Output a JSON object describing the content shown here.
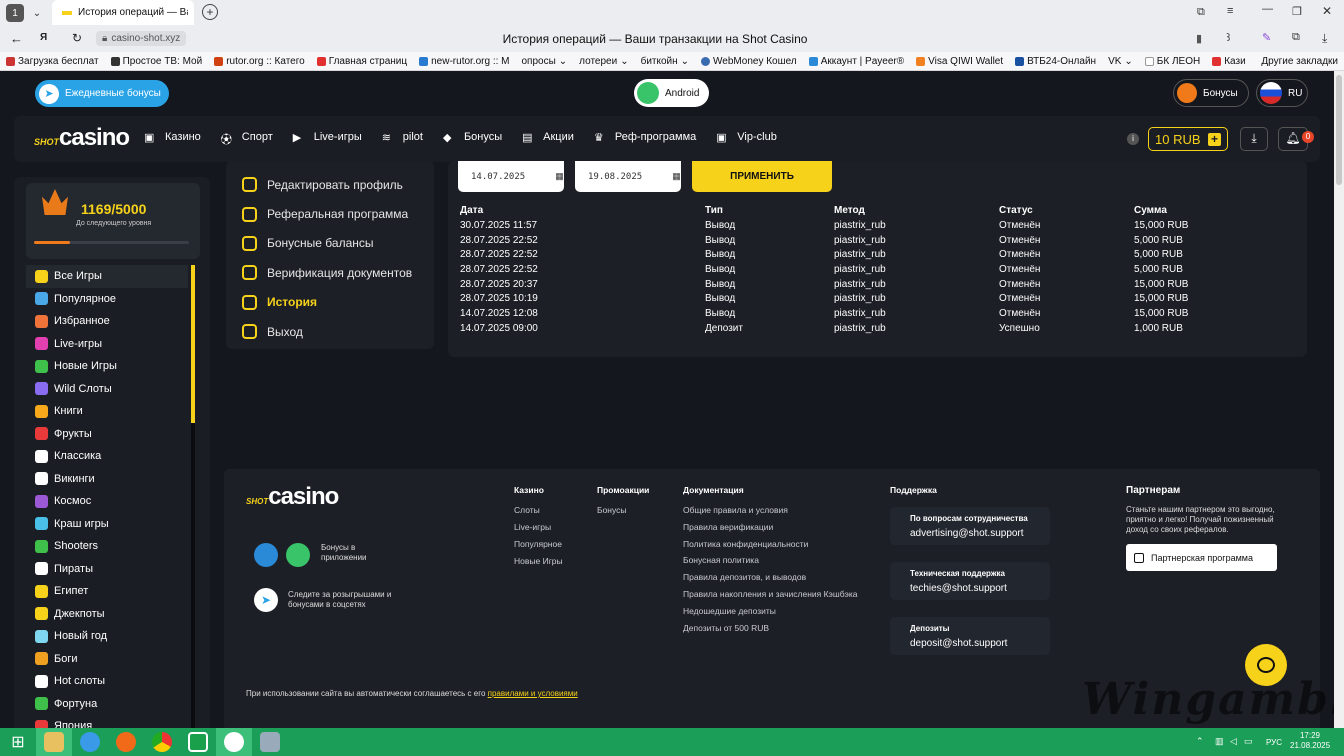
{
  "browser": {
    "tab_count": "1",
    "tab_title": "История операций — Ваши транзакции на Shot Casino",
    "url": "casino-shot.xyz",
    "page_title": "История операций — Ваши транзакции на Shot Casino",
    "bookmarks": [
      "Загрузка бесплат",
      "Простое ТВ: Мой",
      "rutor.org :: Катего",
      "Главная страниц",
      "new-rutor.org :: M",
      "опросы",
      "лотереи",
      "биткойн",
      "WebMoney Кошел",
      "Аккаунт | Payeer®",
      "Visa QIWI Wallet",
      "ВТБ24-Онлайн",
      "VK",
      "БК ЛЕОН",
      "Кази",
      "Другие закладки"
    ]
  },
  "top": {
    "daily_bonus": "Ежедневные бонусы",
    "android": "Android",
    "bonuses": "Бонусы",
    "lang": "RU"
  },
  "nav": {
    "logo_shot": "SHOT",
    "logo_casino": "casino",
    "items": [
      "Казино",
      "Спорт",
      "Live-игры",
      "pilot",
      "Бонусы",
      "Акции",
      "Реф-программа",
      "Vip-club"
    ],
    "balance": "10 RUB",
    "notif_count": "0"
  },
  "level": {
    "progress_text": "1169/5000",
    "subtitle": "До следующего уровня",
    "progress_fraction": 0.2338
  },
  "sidebar": {
    "items": [
      {
        "label": "Все Игры",
        "color": "#f7d21b"
      },
      {
        "label": "Популярное",
        "color": "#4aa8e8"
      },
      {
        "label": "Избранное",
        "color": "#f0743a"
      },
      {
        "label": "Live-игры",
        "color": "#e23fb0"
      },
      {
        "label": "Новые Игры",
        "color": "#3fc04a"
      },
      {
        "label": "Wild Слоты",
        "color": "#8a6cf0"
      },
      {
        "label": "Книги",
        "color": "#f7a81b"
      },
      {
        "label": "Фрукты",
        "color": "#e83a3a"
      },
      {
        "label": "Классика",
        "color": "#ffffff"
      },
      {
        "label": "Викинги",
        "color": "#ffffff"
      },
      {
        "label": "Космос",
        "color": "#9b59d6"
      },
      {
        "label": "Краш игры",
        "color": "#4ac0e8"
      },
      {
        "label": "Shooters",
        "color": "#3fc04a"
      },
      {
        "label": "Пираты",
        "color": "#ffffff"
      },
      {
        "label": "Египет",
        "color": "#f7d21b"
      },
      {
        "label": "Джекпоты",
        "color": "#f7d21b"
      },
      {
        "label": "Новый год",
        "color": "#7fd6f0"
      },
      {
        "label": "Боги",
        "color": "#f0a020"
      },
      {
        "label": "Hot слоты",
        "color": "#ffffff"
      },
      {
        "label": "Фортуна",
        "color": "#3fc04a"
      },
      {
        "label": "Япония",
        "color": "#e83a3a"
      }
    ]
  },
  "profile_menu": {
    "items": [
      "Редактировать профиль",
      "Реферальная программа",
      "Бонусные балансы",
      "Верификация документов",
      "История",
      "Выход"
    ],
    "active": "История"
  },
  "history": {
    "date_from": "14.07.2025",
    "date_to": "19.08.2025",
    "apply": "ПРИМЕНИТЬ",
    "columns": [
      "Дата",
      "Тип",
      "Метод",
      "Статус",
      "Сумма"
    ],
    "rows": [
      [
        "30.07.2025 11:57",
        "Вывод",
        "piastrix_rub",
        "Отменён",
        "15,000 RUB"
      ],
      [
        "28.07.2025 22:52",
        "Вывод",
        "piastrix_rub",
        "Отменён",
        "5,000 RUB"
      ],
      [
        "28.07.2025 22:52",
        "Вывод",
        "piastrix_rub",
        "Отменён",
        "5,000 RUB"
      ],
      [
        "28.07.2025 22:52",
        "Вывод",
        "piastrix_rub",
        "Отменён",
        "5,000 RUB"
      ],
      [
        "28.07.2025 20:37",
        "Вывод",
        "piastrix_rub",
        "Отменён",
        "15,000 RUB"
      ],
      [
        "28.07.2025 10:19",
        "Вывод",
        "piastrix_rub",
        "Отменён",
        "15,000 RUB"
      ],
      [
        "14.07.2025 12:08",
        "Вывод",
        "piastrix_rub",
        "Отменён",
        "15,000 RUB"
      ],
      [
        "14.07.2025 09:00",
        "Депозит",
        "piastrix_rub",
        "Успешно",
        "1,000 RUB"
      ]
    ]
  },
  "footer": {
    "app_bonus": "Бонусы в приложении",
    "social": "Следите за розыгрышами и бонусами в соцсетях",
    "casino_h": "Казино",
    "casino_links": [
      "Слоты",
      "Live-игры",
      "Популярное",
      "Новые Игры"
    ],
    "promo_h": "Промоакции",
    "promo_links": [
      "Бонусы"
    ],
    "docs_h": "Документация",
    "docs_links": [
      "Общие правила и условия",
      "Правила верификации",
      "Политика конфиденциальности",
      "Бонусная политика",
      "Правила депозитов, и выводов",
      "Правила накопления и зачисления Кэшбэка",
      "Недошедшие депозиты",
      "Депозиты от 500 RUB"
    ],
    "support_h": "Поддержка",
    "support": [
      {
        "title": "По вопросам сотрудничества",
        "email": "advertising@shot.support"
      },
      {
        "title": "Техническая поддержка",
        "email": "techies@shot.support"
      },
      {
        "title": "Депозиты",
        "email": "deposit@shot.support"
      }
    ],
    "partners_h": "Партнерам",
    "partners_text": "Станьте нашим партнером это выгодно, приятно и легко! Получай пожизненный доход со своих рефералов.",
    "partners_btn": "Партнерская программа",
    "disclaimer": "При использовании сайта вы автоматически соглашаетесь с его",
    "disclaimer_link": "правилами и условиями"
  },
  "watermark": "Wingamble",
  "taskbar": {
    "lang": "РУС",
    "time": "17:29",
    "date": "21.08.2025"
  }
}
